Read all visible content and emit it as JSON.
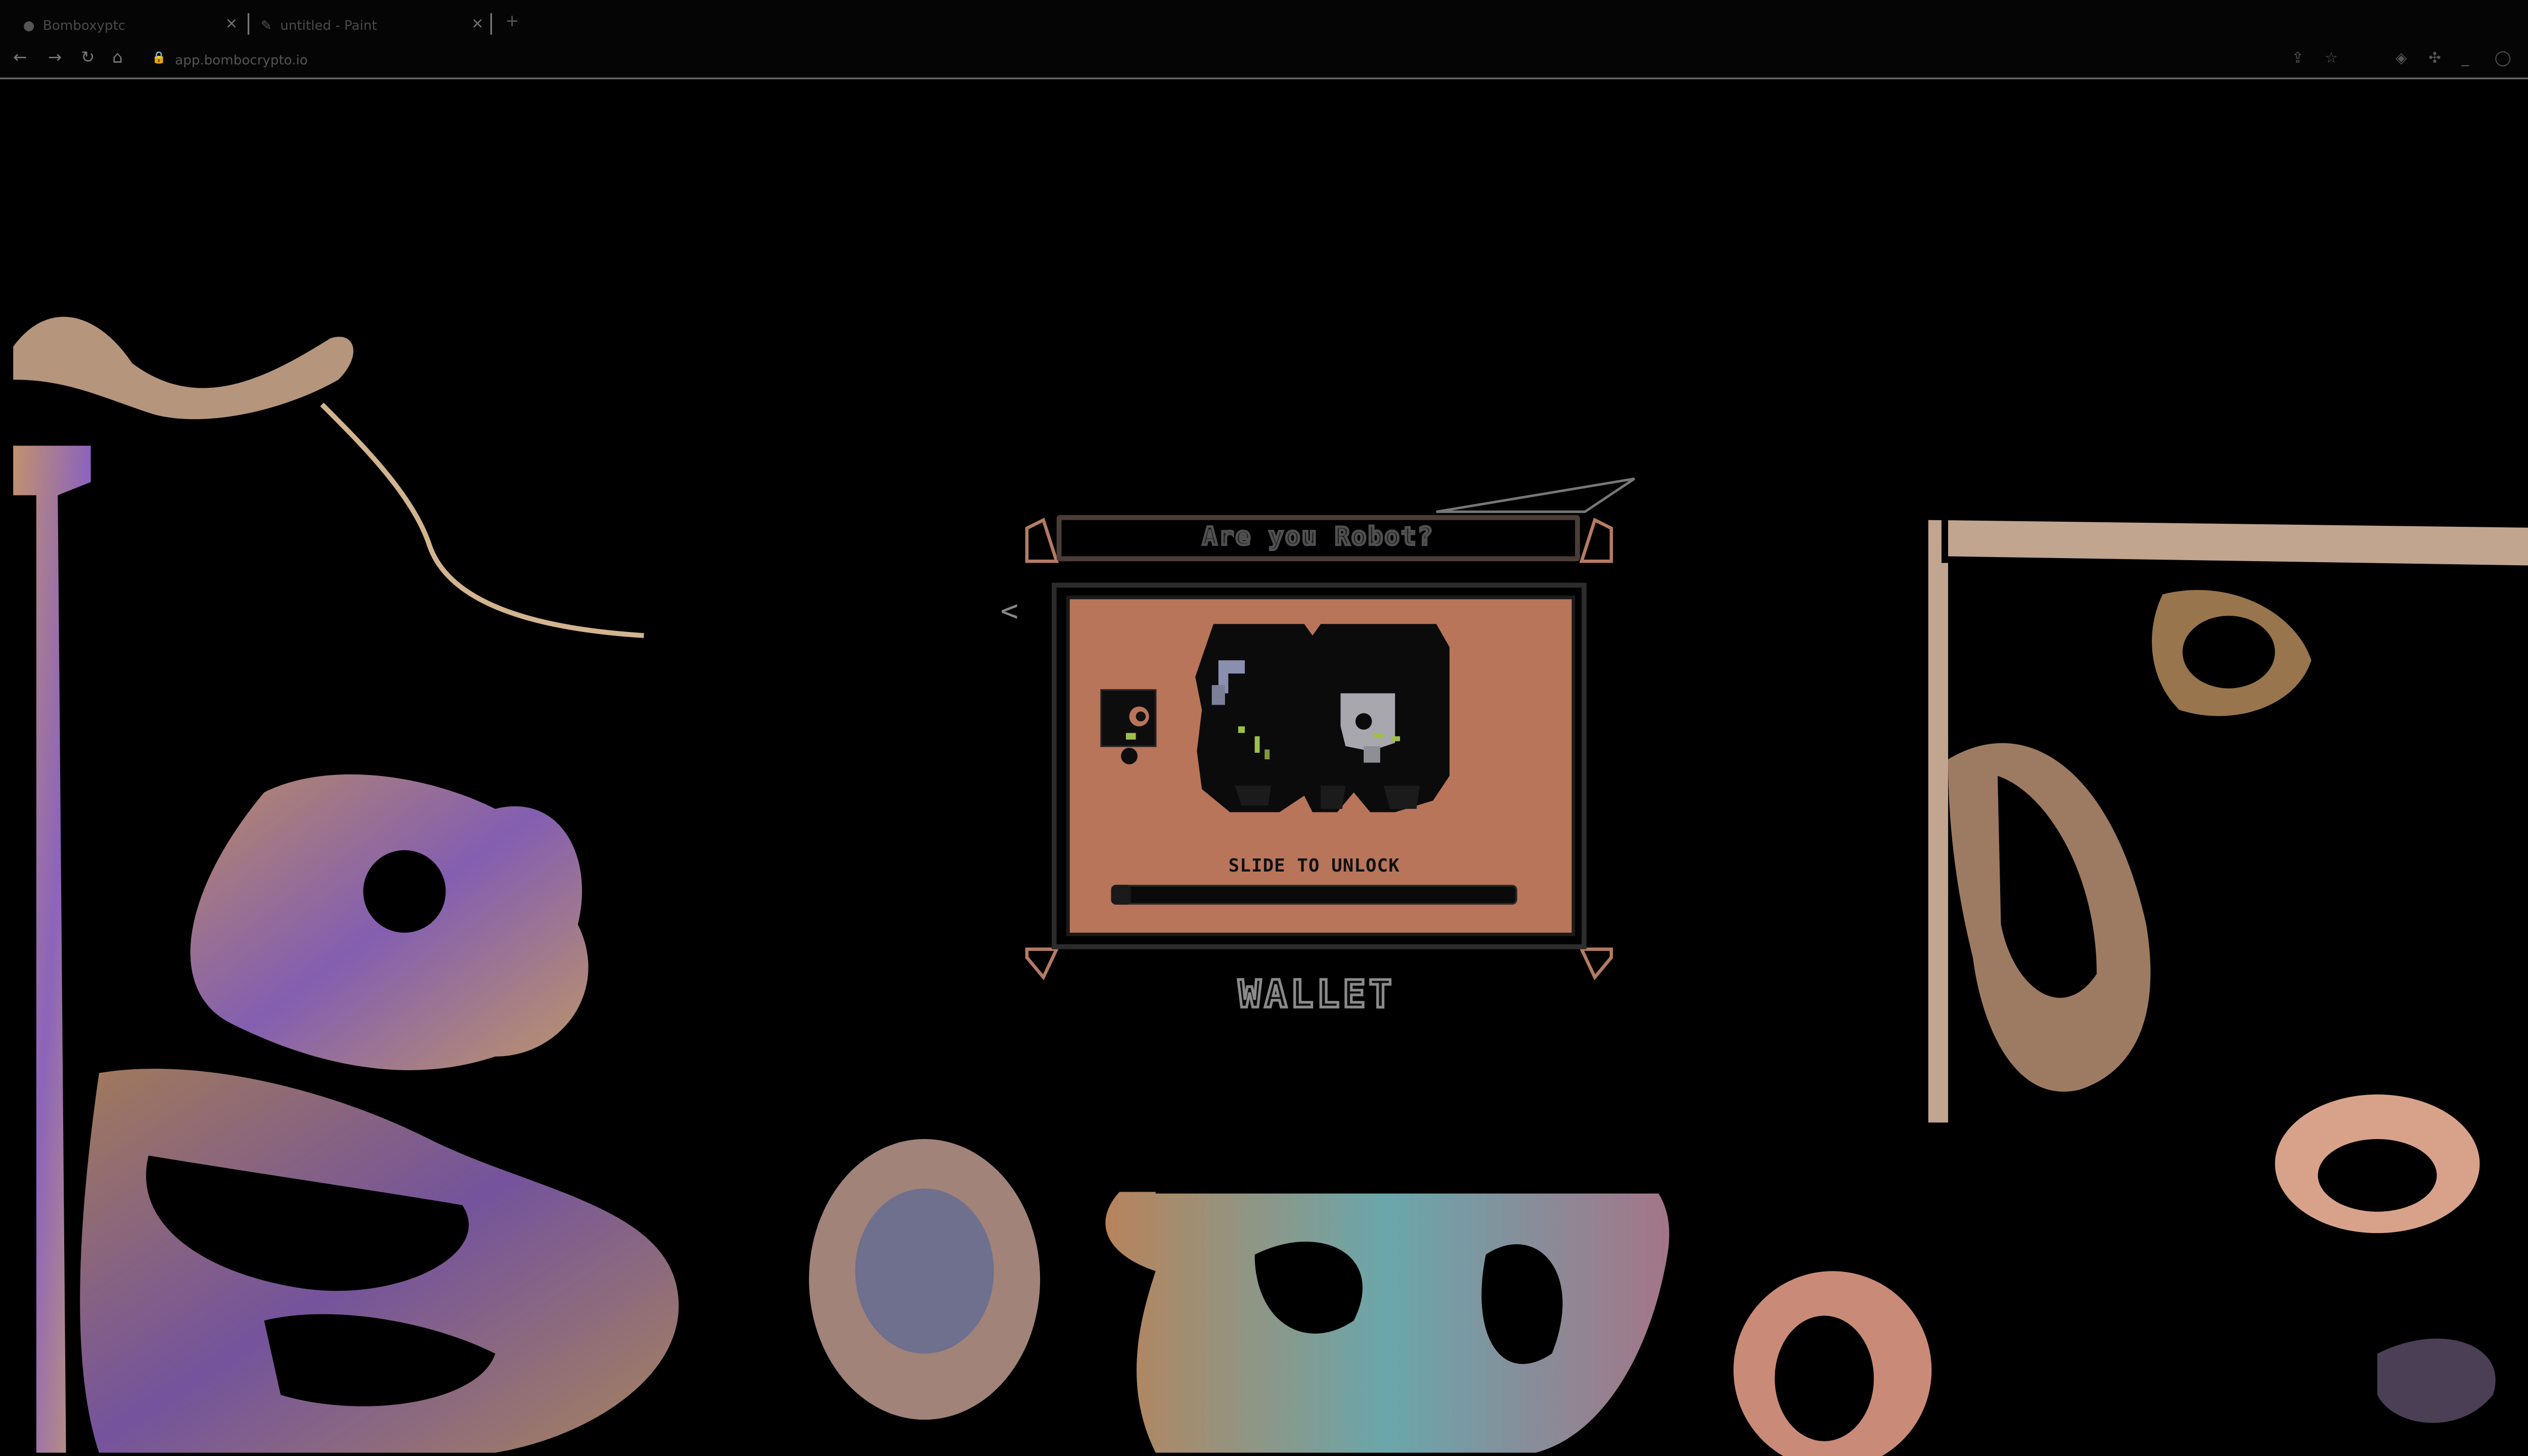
{
  "browser": {
    "tabs": [
      {
        "label": "Bomboxyptc",
        "active": false
      },
      {
        "label": "untitled - Paint",
        "active": true
      }
    ],
    "url": "app.bombocrypto.io"
  },
  "wallet_modal": {
    "title": "Are you Robot?",
    "back_label": "<",
    "slide_label": "SLIDE TO UNLOCK",
    "slider_progress": 0,
    "wallet_label": "WALLET"
  },
  "colors": {
    "panel_bg": "#b8755a",
    "frame": "#4a3d38",
    "background": "#000000"
  }
}
